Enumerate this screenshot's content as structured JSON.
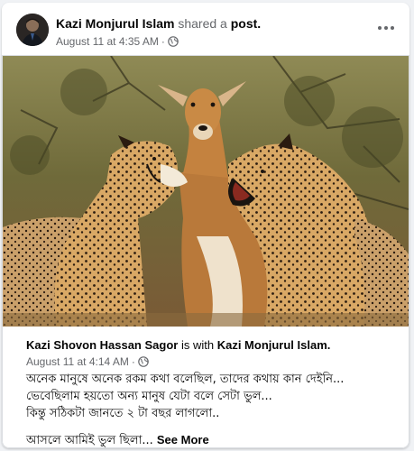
{
  "post": {
    "author": "Kazi Monjurul Islam",
    "action": "shared a",
    "object": "post.",
    "date": "August 11 at 4:35 AM",
    "separator": "·",
    "audience_icon": "globe-icon",
    "more_icon": "more-options-icon"
  },
  "shared": {
    "author": "Kazi Shovon Hassan Sagor",
    "with_word": "is with",
    "tagged": "Kazi Monjurul Islam.",
    "date": "August 11 at 4:14 AM",
    "separator": "·",
    "audience_icon": "globe-icon",
    "lines": [
      "অনেক মানুষে অনেক রকম কথা বলেছিল, তাদের কথায় কান দেইনি...",
      "ভেবেছিলাম হয়তো অন্য মানুষ যেটা বলে সেটা ভুল...",
      "কিন্তু সঠিকটা জানতে ২ টা বছর লাগলো..",
      "আসলে আমিই ভুল ছিলা..."
    ],
    "see_more": "See More"
  },
  "colors": {
    "text_primary": "#050505",
    "text_secondary": "#65676b",
    "card_border": "#dadde1",
    "background": "#f0f2f5"
  }
}
